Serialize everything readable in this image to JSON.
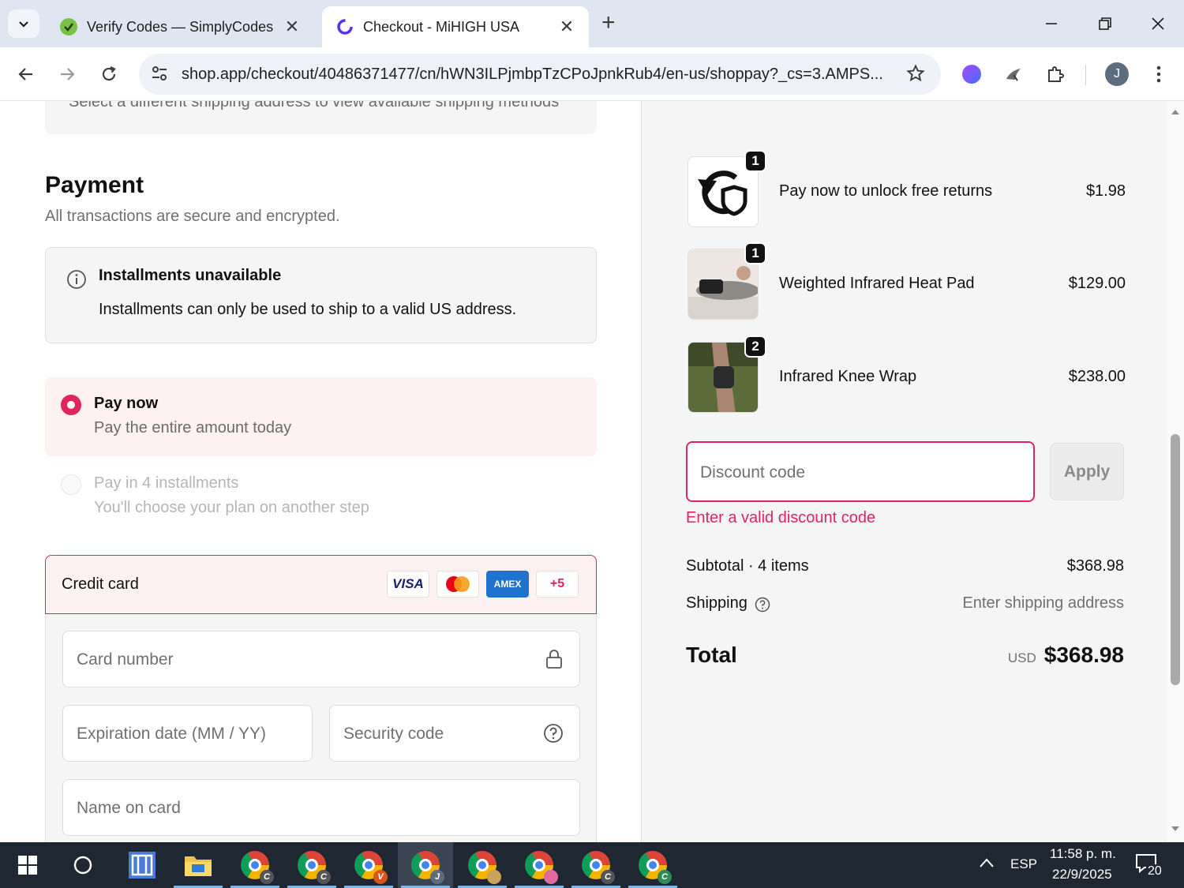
{
  "browser": {
    "tabs": [
      {
        "title": "Verify Codes — SimplyCodes",
        "active": false
      },
      {
        "title": "Checkout - MiHIGH USA",
        "active": true
      }
    ],
    "url": "shop.app/checkout/40486371477/cn/hWN3ILPjmbpTzCPoJpnkRub4/en-us/shoppay?_cs=3.AMPS...",
    "profile_initial": "J"
  },
  "checkout": {
    "address_note": "Select a different shipping address to view available shipping methods",
    "payment_heading": "Payment",
    "payment_sub": "All transactions are secure and encrypted.",
    "notice_title": "Installments unavailable",
    "notice_body": "Installments can only be used to ship to a valid US address.",
    "options": [
      {
        "title": "Pay now",
        "desc": "Pay the entire amount today",
        "selected": true
      },
      {
        "title": "Pay in 4 installments",
        "desc": "You'll choose your plan on another step",
        "selected": false
      }
    ],
    "credit_card_label": "Credit card",
    "card_brands": [
      "VISA",
      "AMEX",
      "+5"
    ],
    "fields": {
      "card_number": "Card number",
      "expiration": "Expiration date (MM / YY)",
      "security_code": "Security code",
      "name_on_card": "Name on card"
    }
  },
  "summary": {
    "items": [
      {
        "name": "Pay now to unlock free returns",
        "price": "$1.98",
        "qty": "1"
      },
      {
        "name": "Weighted Infrared Heat Pad",
        "price": "$129.00",
        "qty": "1"
      },
      {
        "name": "Infrared Knee Wrap",
        "price": "$238.00",
        "qty": "2"
      }
    ],
    "discount_placeholder": "Discount code",
    "apply_label": "Apply",
    "discount_error": "Enter a valid discount code",
    "subtotal_label": "Subtotal · 4 items",
    "subtotal_value": "$368.98",
    "shipping_label": "Shipping",
    "shipping_value": "Enter shipping address",
    "total_label": "Total",
    "currency": "USD",
    "total_value": "$368.98"
  },
  "taskbar": {
    "lang": "ESP",
    "time": "11:58 p. m.",
    "date": "22/9/2025",
    "notifications": "20",
    "chrome_badges": [
      "C",
      "C",
      "V",
      "J",
      "",
      "",
      "C",
      "C"
    ]
  },
  "colors": {
    "accent": "#e0245e",
    "shop_purple": "#5a31f4"
  }
}
